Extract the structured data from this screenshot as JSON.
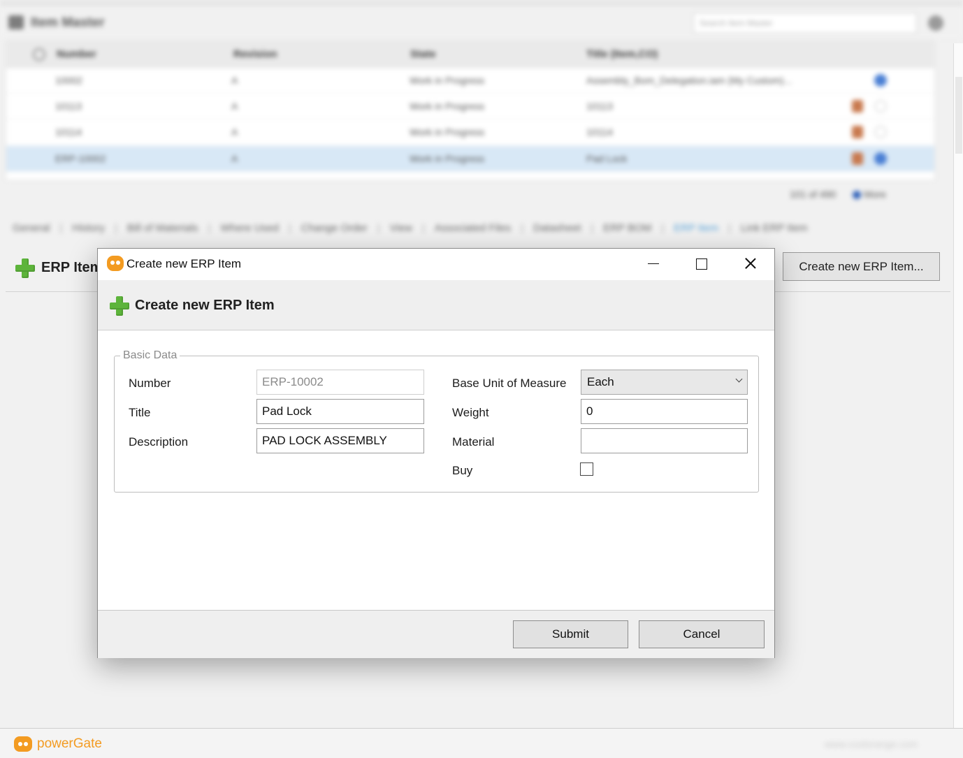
{
  "background": {
    "app_title": "Item Master",
    "search_placeholder": "Search Item Master",
    "grid": {
      "columns": [
        "Number",
        "Revision",
        "State",
        "Title (Item,CO)"
      ],
      "rows": [
        {
          "number": "10002",
          "revision": "A",
          "state": "Work in Progress",
          "title": "Assembly_Bom_Delegation.iam (My Custom)..."
        },
        {
          "number": "10113",
          "revision": "A",
          "state": "Work in Progress",
          "title": "10113"
        },
        {
          "number": "10114",
          "revision": "A",
          "state": "Work in Progress",
          "title": "10114"
        },
        {
          "number": "ERP-10002",
          "revision": "A",
          "state": "Work in Progress",
          "title": "Pad Lock"
        }
      ]
    },
    "paging": {
      "count": "101 of 490",
      "more": "More"
    },
    "tabs": [
      "General",
      "History",
      "Bill of Materials",
      "Where Used",
      "Change Order",
      "View",
      "Associated Files",
      "Datasheet",
      "ERP BOM",
      "ERP Item",
      "Link ERP Item"
    ],
    "active_tab": "ERP Item",
    "panel_title": "ERP Item",
    "create_button": "Create new ERP Item...",
    "footer_brand": "powerGate",
    "footer_site": "www.coolorange.com"
  },
  "dialog": {
    "window_title": "Create new ERP Item",
    "header_title": "Create new ERP Item",
    "group_title": "Basic Data",
    "fields": {
      "number": {
        "label": "Number",
        "value": "ERP-10002"
      },
      "title": {
        "label": "Title",
        "value": "Pad Lock"
      },
      "description": {
        "label": "Description",
        "value": "PAD LOCK ASSEMBLY"
      },
      "unit": {
        "label": "Base Unit of Measure",
        "value": "Each"
      },
      "weight": {
        "label": "Weight",
        "value": "0"
      },
      "material": {
        "label": "Material",
        "value": ""
      },
      "buy": {
        "label": "Buy",
        "checked": false
      }
    },
    "submit_label": "Submit",
    "cancel_label": "Cancel"
  },
  "colors": {
    "accent_green": "#5db43b",
    "brand_orange": "#f39b21",
    "selection_blue": "#d8e8f6"
  }
}
